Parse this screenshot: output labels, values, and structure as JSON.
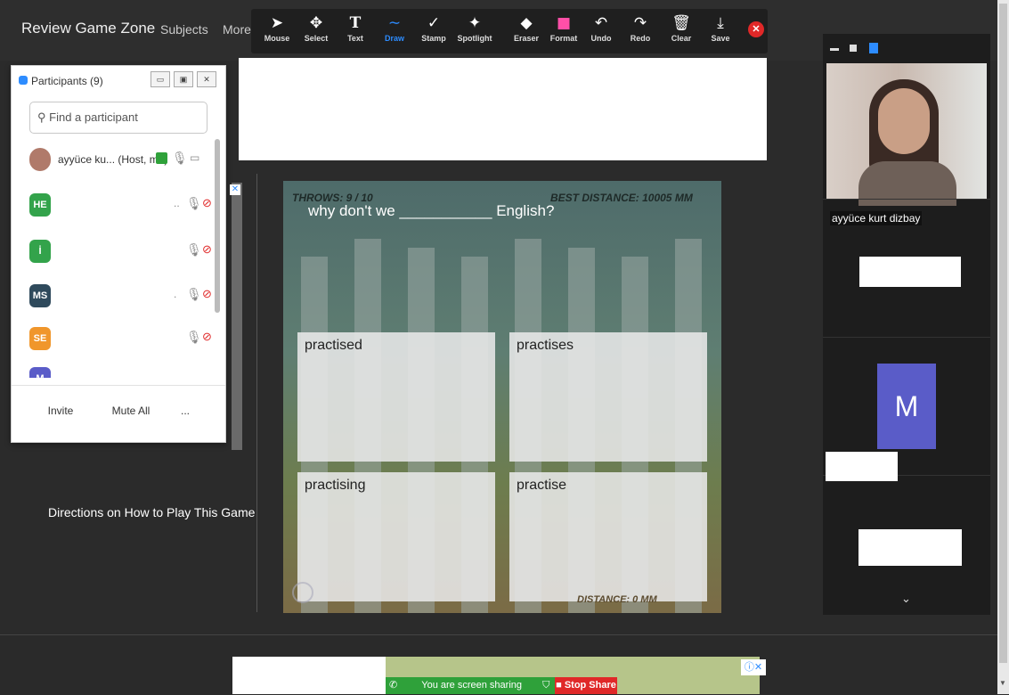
{
  "site": {
    "title": "Review Game Zone",
    "nav_subjects": "Subjects",
    "nav_more": "More"
  },
  "toolbar": {
    "tools": [
      {
        "label": "Mouse",
        "icon": "➤"
      },
      {
        "label": "Select",
        "icon": "✥"
      },
      {
        "label": "Text",
        "icon": "T"
      },
      {
        "label": "Draw",
        "icon": "∼"
      },
      {
        "label": "Stamp",
        "icon": "✓"
      },
      {
        "label": "Spotlight",
        "icon": "✦"
      },
      {
        "label": "Eraser",
        "icon": "◆"
      },
      {
        "label": "Format",
        "icon": "■"
      },
      {
        "label": "Undo",
        "icon": "↶"
      },
      {
        "label": "Redo",
        "icon": "↷"
      },
      {
        "label": "Clear",
        "icon": "🗑"
      },
      {
        "label": "Save",
        "icon": "⤓"
      }
    ],
    "active_tool": "Draw",
    "accent_color": "#2d8cff",
    "format_color": "#ff4fa8"
  },
  "game": {
    "throws": "THROWS:  9 / 10",
    "best_distance": "BEST DISTANCE:   10005  MM",
    "question": "why don't we ___________ English?",
    "answers": [
      "practised",
      "practises",
      "practising",
      "practise"
    ],
    "distance": "DISTANCE:    0    MM"
  },
  "directions": "Directions on How to Play This Game",
  "participants": {
    "title": "Participants (9)",
    "search_placeholder": "Find a participant",
    "rows": [
      {
        "initials": "",
        "name": "ayyüce ku... (Host, me)",
        "color": "#b07a6a"
      },
      {
        "initials": "HE",
        "name": "",
        "color": "#33a34b"
      },
      {
        "initials": "İ",
        "name": "",
        "color": "#33a34b"
      },
      {
        "initials": "MS",
        "name": "",
        "color": "#2f4a5c"
      },
      {
        "initials": "SE",
        "name": "",
        "color": "#f0962b"
      },
      {
        "initials": "M",
        "name": "",
        "color": "#5a5cc8"
      }
    ],
    "invite_label": "Invite",
    "mute_all_label": "Mute All",
    "more_label": "..."
  },
  "video": {
    "host_name": "ayyüce kurt dizbay",
    "tile_letter": "M"
  },
  "share": {
    "sharing_text": "You are screen sharing",
    "stop_label": "Stop Share"
  }
}
